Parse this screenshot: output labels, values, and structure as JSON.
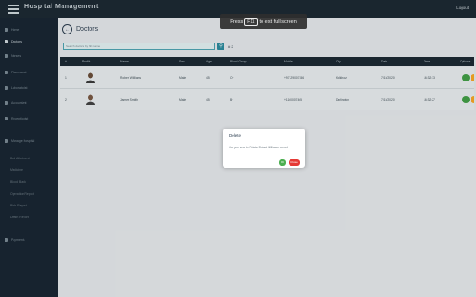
{
  "header": {
    "title": "Hospital Management",
    "logout": "Logout"
  },
  "toast": {
    "prefix": "Press",
    "key": "F11",
    "suffix": "to exit full screen"
  },
  "sidebar": {
    "items": [
      {
        "label": "Home"
      },
      {
        "label": "Doctors",
        "active": true
      },
      {
        "label": "Nurses"
      },
      {
        "label": "Pharmacist"
      },
      {
        "label": "Laboratorist"
      },
      {
        "label": "Accountant"
      },
      {
        "label": "Receptionist"
      },
      {
        "label": "Manage Hospital"
      }
    ],
    "subitems": [
      {
        "label": "Bed Allotment"
      },
      {
        "label": "Medicine"
      },
      {
        "label": "Blood Bank"
      },
      {
        "label": "Operation Report"
      },
      {
        "label": "Birth Report"
      },
      {
        "label": "Death Report"
      }
    ],
    "footer": {
      "label": "Payments"
    }
  },
  "page": {
    "title": "Doctors"
  },
  "search": {
    "placeholder": "Search doctors by full name",
    "count": "# 2"
  },
  "table": {
    "headers": [
      "#",
      "Profile",
      "Name",
      "Sex",
      "Age",
      "Blood Group",
      "Mobile",
      "City",
      "Date",
      "Time",
      "Options"
    ],
    "rows": [
      {
        "num": "1",
        "name": "Robert Williams",
        "sex": "Male",
        "age": "45",
        "blood": "O+",
        "mobile": "+97129007456",
        "city": "Kolkhozi",
        "date": "7/15/2020",
        "time": "16:32:13"
      },
      {
        "num": "2",
        "name": "James Smith",
        "sex": "Male",
        "age": "45",
        "blood": "B+",
        "mobile": "+1160007465",
        "city": "Darlington",
        "date": "7/15/2020",
        "time": "16:32:27"
      }
    ]
  },
  "dialog": {
    "title": "Delete",
    "message": "Are you sure to Delete Robert Williams record",
    "ok": "OK",
    "close": "Close"
  },
  "colors": {
    "sidebar": "#1a2733",
    "header": "#1d2a34",
    "accent": "#2d8d9f",
    "ok": "#4caf50",
    "danger": "#e53935"
  }
}
